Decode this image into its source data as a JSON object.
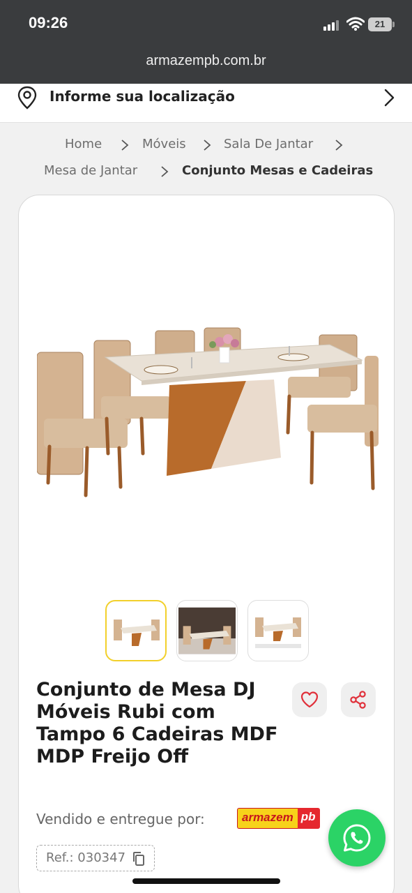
{
  "status_bar": {
    "time": "09:26",
    "battery": "21"
  },
  "browser": {
    "url": "armazempb.com.br"
  },
  "location": {
    "label": "Informe sua localização"
  },
  "breadcrumb": {
    "items": [
      "Home",
      "Móveis",
      "Sala De Jantar",
      "Mesa de Jantar"
    ],
    "current": "Conjunto Mesas e Cadeiras"
  },
  "product": {
    "title": "Conjunto de Mesa DJ Móveis Rubi com Tampo 6 Cadeiras MDF MDP Freijo Off",
    "seller_label": "Vendido e entregue por:",
    "seller_logo": {
      "part1": "armazem",
      "part2": "pb"
    },
    "ref": "Ref.: 030347",
    "thumbnails": 3,
    "active_thumbnail": 0
  },
  "colors": {
    "header_bg": "#3a3c3e",
    "accent_yellow": "#f2d02b",
    "heart_red": "#e0303a",
    "whatsapp_green": "#2bd366"
  }
}
